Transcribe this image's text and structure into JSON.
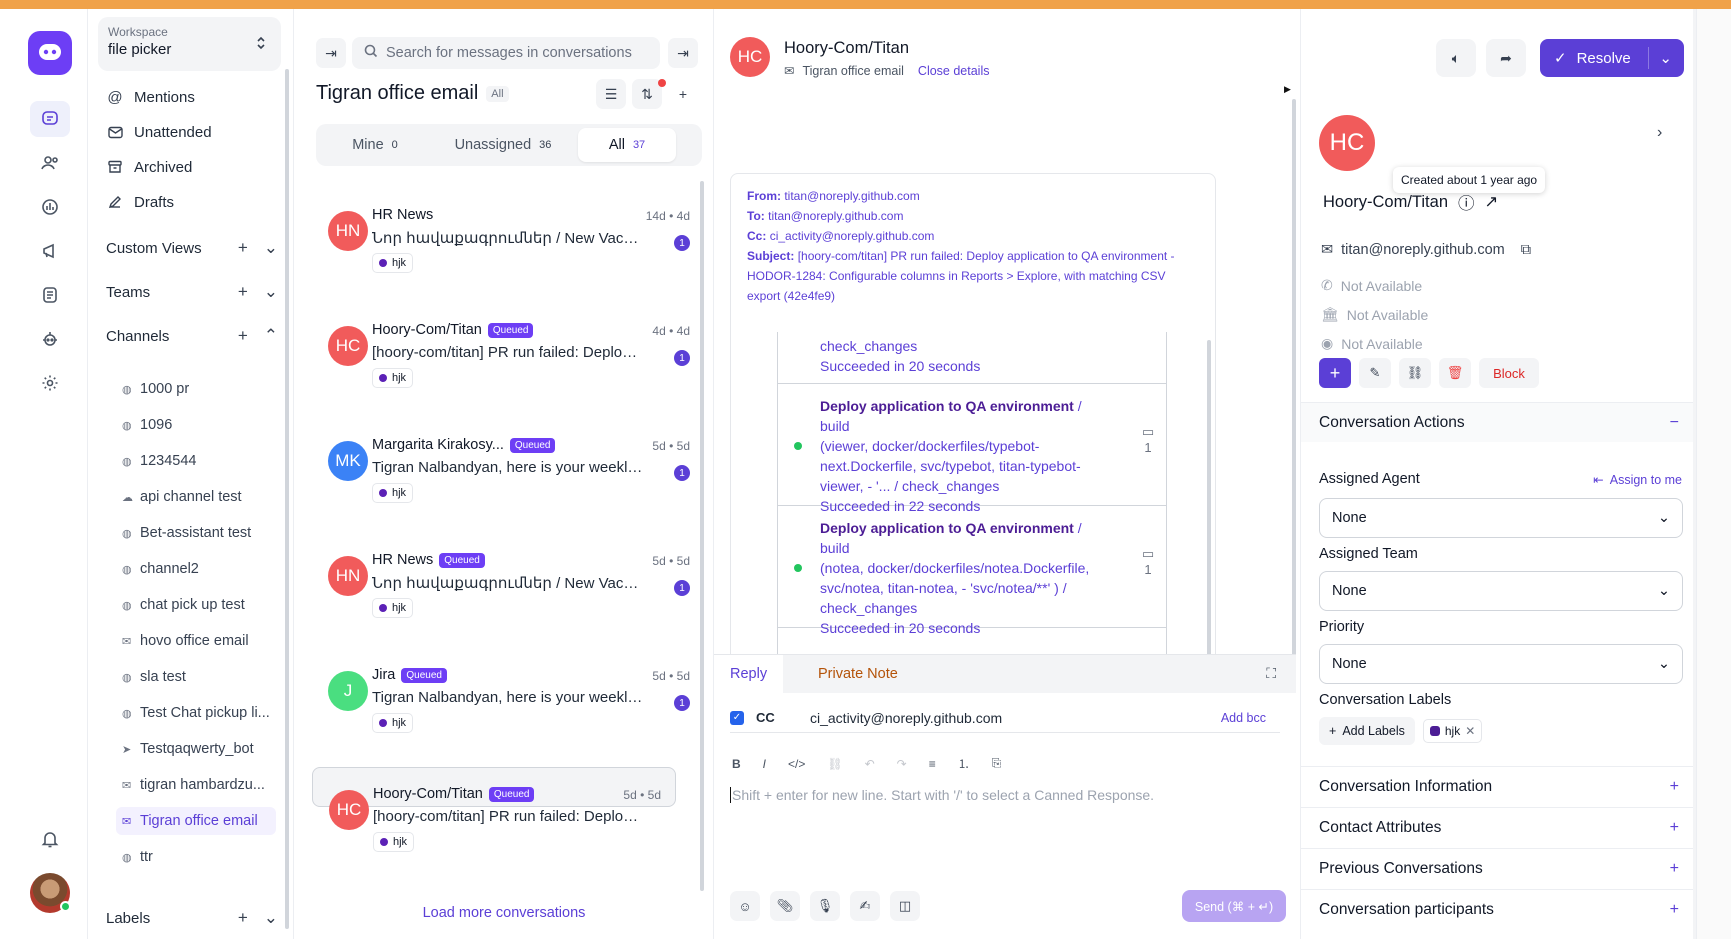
{
  "colors": {
    "brand": "#6d3ef5",
    "accent": "#5b3fd6",
    "avatar_red": "#f15b5b",
    "avatar_blue": "#3b82f6",
    "avatar_green": "#4ade80",
    "top_stripe": "#f0a24a"
  },
  "rail": {
    "icons": [
      "chat-bubble-icon",
      "contacts-icon",
      "reports-icon",
      "campaigns-icon",
      "help-center-icon",
      "captain-bot-icon",
      "settings-icon",
      "notifications-bell-icon"
    ]
  },
  "workspace": {
    "label": "Workspace",
    "name": "file picker"
  },
  "sidebar": {
    "main_items": [
      {
        "label": "Mentions",
        "icon": "at-icon"
      },
      {
        "label": "Unattended",
        "icon": "envelope-icon"
      },
      {
        "label": "Archived",
        "icon": "archive-icon"
      },
      {
        "label": "Drafts",
        "icon": "pen-icon"
      }
    ],
    "custom_views": "Custom Views",
    "teams": "Teams",
    "channels": "Channels",
    "channel_items": [
      {
        "label": "1000 pr",
        "icon": "globe-icon"
      },
      {
        "label": "1096",
        "icon": "globe-icon"
      },
      {
        "label": "1234544",
        "icon": "globe-icon"
      },
      {
        "label": "api channel test",
        "icon": "cloud-icon"
      },
      {
        "label": "Bet-assistant test",
        "icon": "globe-icon"
      },
      {
        "label": "channel2",
        "icon": "globe-icon"
      },
      {
        "label": "chat pick up test",
        "icon": "globe-icon"
      },
      {
        "label": "hovo office email",
        "icon": "mail-icon"
      },
      {
        "label": "sla test",
        "icon": "globe-icon"
      },
      {
        "label": "Test Chat pickup li...",
        "icon": "globe-icon"
      },
      {
        "label": "Testqaqwerty_bot",
        "icon": "telegram-icon"
      },
      {
        "label": "tigran hambardzu...",
        "icon": "mail-icon"
      },
      {
        "label": "Tigran office email",
        "icon": "mail-icon"
      },
      {
        "label": "ttr",
        "icon": "globe-icon"
      }
    ],
    "labels": "Labels"
  },
  "list": {
    "search_placeholder": "Search for messages in conversations",
    "title": "Tigran office email",
    "filter_pill": "All",
    "tabs": [
      {
        "label": "Mine",
        "count": "0"
      },
      {
        "label": "Unassigned",
        "count": "36"
      },
      {
        "label": "All",
        "count": "37"
      }
    ],
    "conversations": [
      {
        "initials": "HN",
        "name": "HR News",
        "queued": "",
        "time": "14d • 4d",
        "message": "Նոր հավաքագրումներ / New Vacancies",
        "unread": "1",
        "label": "hjk"
      },
      {
        "initials": "HC",
        "name": "Hoory-Com/Titan",
        "queued": "Queued",
        "time": "4d • 4d",
        "message": "[hoory-com/titan] PR run failed: Deploy application to QA",
        "unread": "1",
        "label": "hjk"
      },
      {
        "initials": "MK",
        "name": "Margarita Kirakosy...",
        "queued": "Queued",
        "time": "5d • 5d",
        "message": "Tigran Nalbandyan, here is your weekly summary",
        "unread": "1",
        "label": "hjk"
      },
      {
        "initials": "HN",
        "name": "HR News",
        "queued": "Queued",
        "time": "5d • 5d",
        "message": "Նոր հավաքագրումներ / New Vacancies",
        "unread": "1",
        "label": "hjk"
      },
      {
        "initials": "J",
        "name": "Jira",
        "queued": "Queued",
        "time": "5d • 5d",
        "message": "Tigran Nalbandyan, here is your weekly summary",
        "unread": "1",
        "label": "hjk"
      },
      {
        "initials": "HC",
        "name": "Hoory-Com/Titan",
        "queued": "Queued",
        "time": "5d • 5d",
        "message": "[hoory-com/titan] PR run failed: Deploy application",
        "unread": "",
        "label": "hjk"
      }
    ],
    "load_more": "Load more conversations"
  },
  "conversation": {
    "initials": "HC",
    "name": "Hoory-Com/Titan",
    "inbox": "Tigran office email",
    "close_details": "Close details",
    "resolve": "Resolve",
    "email": {
      "from_label": "From:",
      "from": "titan@noreply.github.com",
      "to_label": "To:",
      "to": "titan@noreply.github.com",
      "cc_label": "Cc:",
      "cc": "ci_activity@noreply.github.com",
      "subject_label": "Subject:",
      "subject_line1": "[hoory-com/titan] PR run failed: Deploy application to QA environment -",
      "subject_line2": "HODOR-1284: Configurable columns in Reports > Explore, with matching CSV",
      "subject_line3": "export (42e4fe9)"
    },
    "checks": [
      {
        "lines": [
          "check_changes",
          "Succeeded in 20 seconds"
        ]
      },
      {
        "title": "Deploy application to QA environment",
        "lines": [
          "/ build",
          "(viewer, docker/dockerfiles/typebot-",
          "next.Dockerfile, svc/typebot, titan-typebot-",
          "viewer, - '... / check_changes",
          "Succeeded in 22 seconds"
        ],
        "comments": "1"
      },
      {
        "title": "Deploy application to QA environment",
        "lines": [
          "/ build",
          "(notea, docker/dockerfiles/notea.Dockerfile,",
          "svc/notea, titan-notea, - 'svc/notea/**' ) /",
          "check_changes",
          "Succeeded in 20 seconds"
        ],
        "comments": "1"
      }
    ]
  },
  "reply": {
    "tab_reply": "Reply",
    "tab_note": "Private Note",
    "cc_label": "CC",
    "cc_value": "ci_activity@noreply.github.com",
    "add_bcc": "Add bcc",
    "format": [
      "B",
      "I",
      "</>",
      "⛓",
      "↶",
      "↷",
      "≡",
      "⒈",
      "⎘"
    ],
    "placeholder": "Shift + enter for new line. Start with '/' to select a Canned Response.",
    "send": "Send (⌘ + ↵)"
  },
  "contact": {
    "initials": "HC",
    "tooltip": "Created about 1 year ago",
    "name": "Hoory-Com/Titan",
    "email": "titan@noreply.github.com",
    "phone": "Not Available",
    "company": "Not Available",
    "social": "Not Available",
    "block": "Block",
    "sections": {
      "actions": "Conversation Actions",
      "info": "Conversation Information",
      "attributes": "Contact Attributes",
      "previous": "Previous Conversations",
      "participants": "Conversation participants"
    },
    "assigned_agent_label": "Assigned Agent",
    "assign_to_me": "Assign to me",
    "assigned_agent": "None",
    "assigned_team_label": "Assigned Team",
    "assigned_team": "None",
    "priority_label": "Priority",
    "priority": "None",
    "labels_label": "Conversation Labels",
    "add_labels": "Add Labels",
    "label_chip": "hjk"
  }
}
